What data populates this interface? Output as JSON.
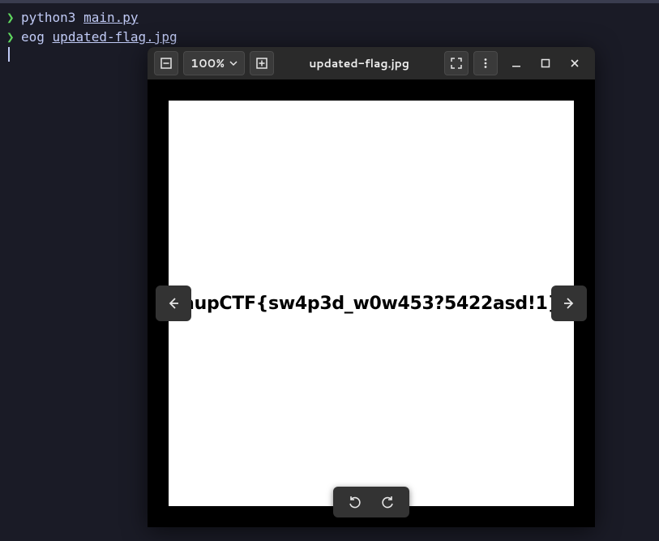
{
  "terminal": {
    "lines": [
      {
        "prompt": "❯",
        "cmd": "python3",
        "arg": "main.py"
      },
      {
        "prompt": "❯",
        "cmd": "eog",
        "arg": "updated-flag.jpg"
      }
    ]
  },
  "viewer": {
    "zoom_level": "100%",
    "title": "updated-flag.jpg",
    "flag_text": "aupCTF{sw4p3d_w0w453?5422asd!1}"
  }
}
